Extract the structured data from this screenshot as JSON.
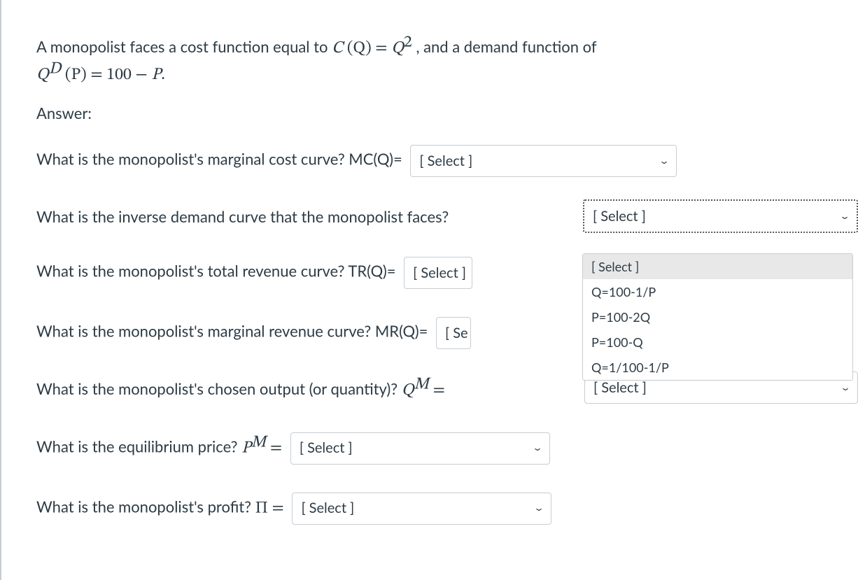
{
  "intro": {
    "prefix": "A monopolist faces a cost function equal to ",
    "cost_lhs_fn": "C",
    "cost_lhs_arg": "(Q)",
    "eq": " = ",
    "cost_rhs_base": "Q",
    "cost_rhs_exp": "2",
    "mid": " , and a demand function of",
    "demand_lhs_Q": "Q",
    "demand_sup": "D",
    "demand_arg": " (P)",
    "demand_eq": " = 100 − ",
    "demand_P": "P",
    "period": "."
  },
  "answer_label": "Answer:",
  "questions": {
    "q1": {
      "text": "What is the monopolist's marginal cost curve? MC(Q)=",
      "select": "[ Select ]"
    },
    "q2": {
      "text": "What is the inverse demand curve that the monopolist faces?",
      "select": "[ Select ]"
    },
    "q3": {
      "text": "What is the monopolist's total revenue curve? TR(Q)=",
      "select": "[ Select ]"
    },
    "q4": {
      "text": "What is the monopolist's marginal revenue curve? MR(Q)=",
      "select_trunc": "[ Select ]"
    },
    "q5": {
      "pre": "What is the monopolist's chosen output (or quantity)? ",
      "var": "Q",
      "sup": "M",
      "eq": " =",
      "select": "[ Select ]"
    },
    "q6": {
      "pre": "What is the equilibrium price? ",
      "var": "P",
      "sup": "M",
      "eq": " =",
      "select": "[ Select ]"
    },
    "q7": {
      "pre": "What is the monopolist's profit? ",
      "var": "Π",
      "eq": " =",
      "select": "[ Select ]"
    }
  },
  "dropdown": {
    "options": [
      "[ Select ]",
      "Q=100-1/P",
      "P=100-2Q",
      "P=100-Q",
      "Q=1/100-1/P"
    ]
  }
}
